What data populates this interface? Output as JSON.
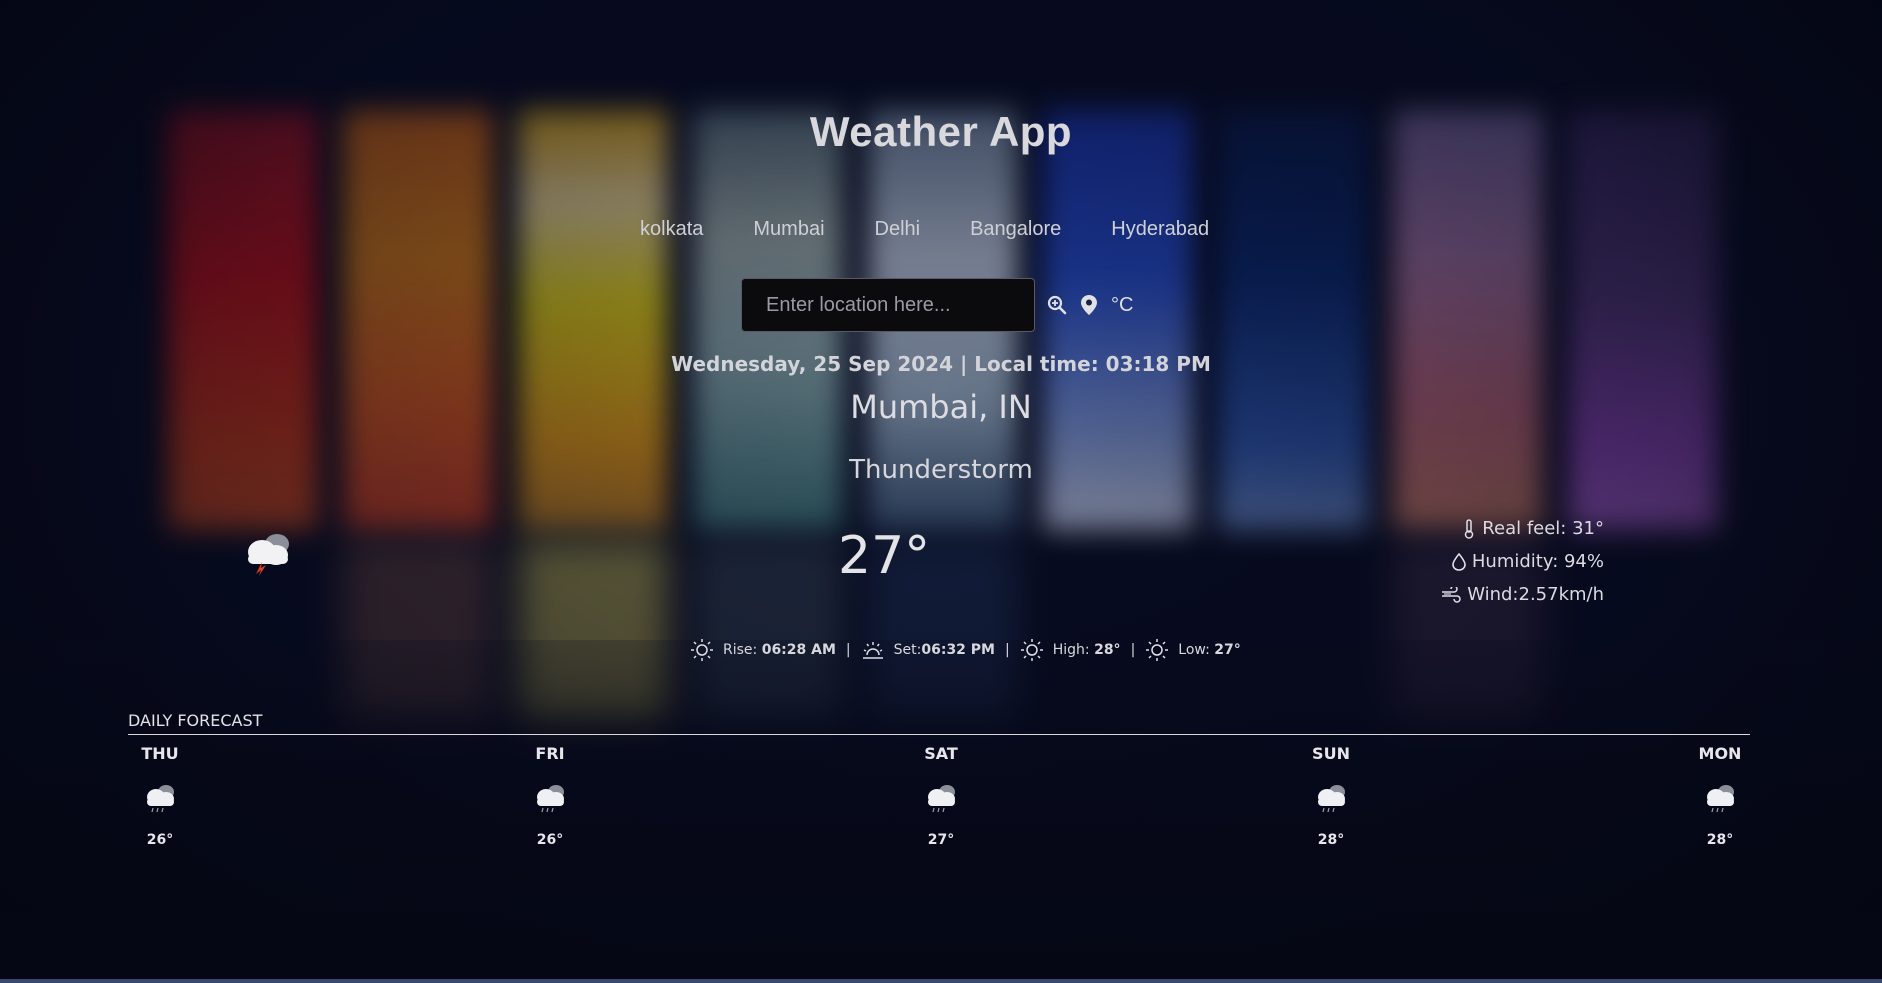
{
  "app": {
    "title": "Weather App"
  },
  "cities": [
    "kolkata",
    "Mumbai",
    "Delhi",
    "Bangalore",
    "Hyderabad"
  ],
  "search": {
    "placeholder": "Enter location here...",
    "unit_label": "°C"
  },
  "current": {
    "datetime": "Wednesday, 25 Sep 2024 | Local time: 03:18 PM",
    "location": "Mumbai, IN",
    "condition": "Thunderstorm",
    "temp": "27°",
    "icon": "thunderstorm-cloud-icon"
  },
  "details": {
    "real_feel": "Real feel: 31°",
    "humidity": "Humidity: 94%",
    "wind": "Wind:2.57km/h"
  },
  "sun": {
    "rise_label": "Rise:",
    "rise": "06:28 AM",
    "set_label": "Set:",
    "set": "06:32 PM",
    "high_label": "High:",
    "high": "28°",
    "low_label": "Low:",
    "low": "27°"
  },
  "forecast": {
    "title": "DAILY FORECAST",
    "days": [
      {
        "name": "THU",
        "temp": "26°",
        "icon": "rain-cloud-icon"
      },
      {
        "name": "FRI",
        "temp": "26°",
        "icon": "rain-cloud-icon"
      },
      {
        "name": "SAT",
        "temp": "27°",
        "icon": "rain-cloud-icon"
      },
      {
        "name": "SUN",
        "temp": "28°",
        "icon": "rain-cloud-icon"
      },
      {
        "name": "MON",
        "temp": "28°",
        "icon": "rain-cloud-icon"
      }
    ]
  },
  "colors": {
    "background": "#070b1c",
    "text": "#e6e6ea",
    "input_bg": "#0b0b0d"
  }
}
